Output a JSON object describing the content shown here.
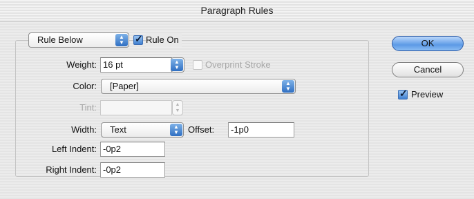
{
  "window": {
    "title": "Paragraph Rules"
  },
  "rule": {
    "type_value": "Rule Below",
    "rule_on_label": "Rule On",
    "rule_on_checked": true
  },
  "weight": {
    "label": "Weight:",
    "value": "16 pt"
  },
  "overprint": {
    "label": "Overprint Stroke",
    "checked": false,
    "enabled": false
  },
  "color": {
    "label": "Color:",
    "value": "[Paper]"
  },
  "tint": {
    "label": "Tint:",
    "value": ""
  },
  "width": {
    "label": "Width:",
    "value": "Text"
  },
  "offset": {
    "label": "Offset:",
    "value": "-1p0"
  },
  "left_indent": {
    "label": "Left Indent:",
    "value": "-0p2"
  },
  "right_indent": {
    "label": "Right Indent:",
    "value": "-0p2"
  },
  "buttons": {
    "ok": "OK",
    "cancel": "Cancel"
  },
  "preview": {
    "label": "Preview",
    "checked": true
  }
}
